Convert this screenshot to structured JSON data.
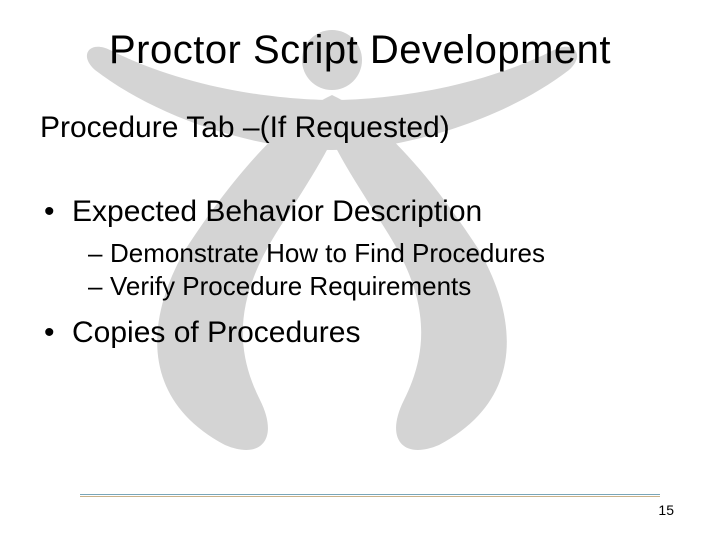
{
  "slide": {
    "title": "Proctor Script Development",
    "subtitle": "Procedure Tab –(If Requested)",
    "bullets": [
      {
        "text": "Expected Behavior Description",
        "children": [
          "Demonstrate How to Find Procedures",
          "Verify Procedure Requirements"
        ]
      },
      {
        "text": "Copies of Procedures",
        "children": []
      }
    ],
    "page_number": "15"
  }
}
